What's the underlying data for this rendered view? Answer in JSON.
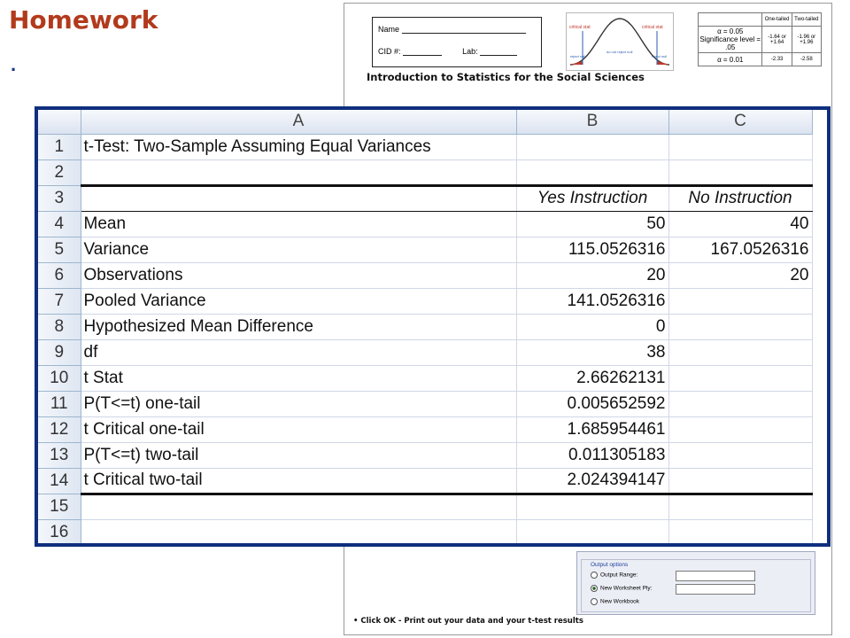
{
  "slide": {
    "title": "Homework",
    "bullet": "."
  },
  "worksheet": {
    "name_label": "Name",
    "cid_label": "CID #:",
    "lab_label": "Lab:",
    "heading": "Introduction to Statistics for the Social Sciences",
    "figure": {
      "left_label": "critical stat",
      "right_label": "critical stat",
      "left_region": "reject null",
      "center_region": "do not reject null",
      "right_region": "reject null"
    },
    "alpha_table": {
      "col_one_tailed": "One-tailed",
      "col_two_tailed": "Two-tailed",
      "rows": [
        {
          "alpha": "α = 0.05",
          "sub": "Significance level = .05",
          "one": "-1.64 or +1.64",
          "two": "-1.96 or +1.96"
        },
        {
          "alpha": "α = 0.01",
          "sub": "",
          "one": "-2.33",
          "two": "-2.58"
        }
      ]
    },
    "output_options": {
      "group_label": "Output options",
      "output_range": "Output Range:",
      "new_worksheet": "New Worksheet Ply:",
      "new_workbook": "New Workbook"
    },
    "footer": "Click OK - Print out your data and your t-test results"
  },
  "excel": {
    "columns": [
      "A",
      "B",
      "C"
    ],
    "rows": [
      {
        "n": "1",
        "a": "t-Test: Two-Sample Assuming Equal Variances",
        "b": "",
        "c": ""
      },
      {
        "n": "2",
        "a": "",
        "b": "",
        "c": ""
      },
      {
        "n": "3",
        "a": "",
        "b": "Yes Instruction",
        "c": "No Instruction"
      },
      {
        "n": "4",
        "a": "Mean",
        "b": "50",
        "c": "40"
      },
      {
        "n": "5",
        "a": "Variance",
        "b": "115.0526316",
        "c": "167.0526316"
      },
      {
        "n": "6",
        "a": "Observations",
        "b": "20",
        "c": "20"
      },
      {
        "n": "7",
        "a": "Pooled Variance",
        "b": "141.0526316",
        "c": ""
      },
      {
        "n": "8",
        "a": "Hypothesized Mean Difference",
        "b": "0",
        "c": ""
      },
      {
        "n": "9",
        "a": "df",
        "b": "38",
        "c": ""
      },
      {
        "n": "10",
        "a": "t Stat",
        "b": "2.66262131",
        "c": ""
      },
      {
        "n": "11",
        "a": "P(T<=t) one-tail",
        "b": "0.005652592",
        "c": ""
      },
      {
        "n": "12",
        "a": "t Critical one-tail",
        "b": "1.685954461",
        "c": ""
      },
      {
        "n": "13",
        "a": "P(T<=t) two-tail",
        "b": "0.011305183",
        "c": ""
      },
      {
        "n": "14",
        "a": "t Critical two-tail",
        "b": "2.024394147",
        "c": ""
      },
      {
        "n": "15",
        "a": "",
        "b": "",
        "c": ""
      },
      {
        "n": "16",
        "a": "",
        "b": "",
        "c": ""
      }
    ]
  }
}
